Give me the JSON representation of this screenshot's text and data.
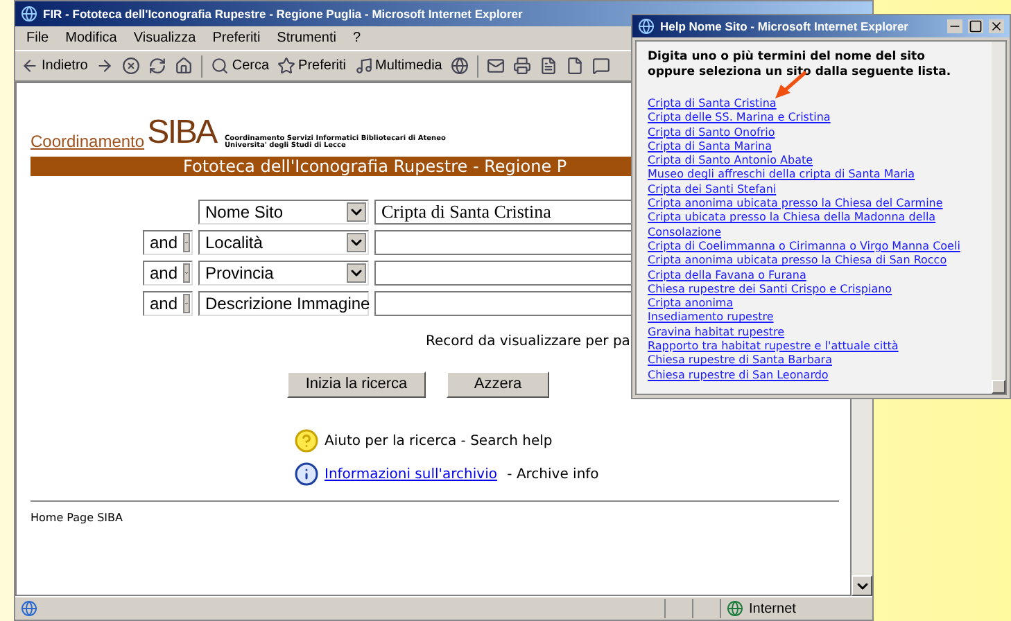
{
  "main_window": {
    "title": "FIR - Fototeca dell'Iconografia Rupestre - Regione Puglia - Microsoft Internet Explorer",
    "menu": [
      {
        "label": "File"
      },
      {
        "label": "Modifica"
      },
      {
        "label": "Visualizza"
      },
      {
        "label": "Preferiti"
      },
      {
        "label": "Strumenti"
      },
      {
        "label": "?"
      }
    ],
    "toolbar": [
      {
        "kind": "back",
        "label": "Indietro"
      },
      {
        "kind": "forward"
      },
      {
        "kind": "stop"
      },
      {
        "kind": "refresh"
      },
      {
        "kind": "home"
      },
      {
        "kind": "separator"
      },
      {
        "kind": "search",
        "label": "Cerca"
      },
      {
        "kind": "favorites",
        "label": "Preferiti"
      },
      {
        "kind": "media",
        "label": "Multimedia"
      },
      {
        "kind": "history"
      },
      {
        "kind": "separator"
      },
      {
        "kind": "mail"
      },
      {
        "kind": "print"
      },
      {
        "kind": "edit"
      },
      {
        "kind": "page"
      },
      {
        "kind": "discuss"
      }
    ],
    "page": {
      "logo": {
        "prefix": "Coordinamento",
        "wordmark": "SIBA",
        "line_1": "Coordinamento Servizi Informatici Bibliotecari di Ateneo",
        "line_2": "Universita' degli Studi di Lecce"
      },
      "banner": "Fototeca dell'Iconografia Rupestre - Regione P",
      "search_rows": [
        {
          "field": "Nome Sito",
          "value": "Cripta di Santa Cristina"
        },
        {
          "operator": "and",
          "field": "Località"
        },
        {
          "operator": "and",
          "field": "Provincia"
        },
        {
          "operator": "and",
          "field": "Descrizione Immagine"
        }
      ],
      "record_text": "Record da visualizzare per pa",
      "buttons": [
        "Inizia la ricerca",
        "Azzera"
      ],
      "help": [
        {
          "kind": "help",
          "text": "Aiuto per la ricerca - Search help"
        },
        {
          "kind": "info",
          "link": "Informazioni sull'archivio",
          "text": " - Archive info"
        }
      ],
      "footer": "Home Page SIBA"
    },
    "status_bar": {
      "zone": "Internet"
    }
  },
  "popup": {
    "title": "Help Nome Sito - Microsoft Internet Explorer",
    "intro": "Digita uno o più termini del nome del sito oppure seleziona un sito dalla seguente lista.",
    "links": [
      "Cripta di Santa Cristina",
      "Cripta delle SS. Marina e Cristina",
      "Cripta di Santo Onofrio",
      "Cripta di Santa Marina",
      "Cripta di Santo Antonio Abate",
      "Museo degli affreschi della cripta di Santa Maria",
      "Cripta dei Santi Stefani",
      "Cripta anonima ubicata presso la Chiesa del Carmine",
      "Cripta ubicata presso la Chiesa della Madonna della Consolazione",
      "Cripta di Coelimmanna o Cirimanna o Virgo Manna Coeli",
      "Cripta anonima ubicata presso la Chiesa di San Rocco",
      "Cripta della Favana o Furana",
      "Chiesa rupestre dei Santi Crispo e Crispiano",
      "Cripta anonima",
      "Insediamento rupestre",
      "Gravina habitat rupestre",
      "Rapporto tra habitat rupestre e l'attuale città",
      "Chiesa rupestre di Santa Barbara",
      "Chiesa rupestre di San Leonardo"
    ]
  }
}
